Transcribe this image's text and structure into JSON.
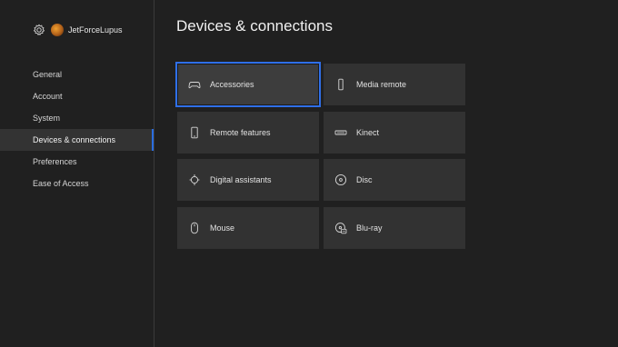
{
  "profile": {
    "gamertag": "JetForceLupus",
    "icons": [
      "gear-icon",
      "avatar"
    ]
  },
  "sidebar": {
    "items": [
      {
        "label": "General"
      },
      {
        "label": "Account"
      },
      {
        "label": "System"
      },
      {
        "label": "Devices & connections",
        "active": true
      },
      {
        "label": "Preferences"
      },
      {
        "label": "Ease of Access"
      }
    ]
  },
  "main": {
    "title": "Devices & connections",
    "tiles": [
      {
        "label": "Accessories",
        "icon": "controller-icon",
        "selected": true
      },
      {
        "label": "Media remote",
        "icon": "remote-icon"
      },
      {
        "label": "Remote features",
        "icon": "phone-icon"
      },
      {
        "label": "Kinect",
        "icon": "kinect-icon"
      },
      {
        "label": "Digital assistants",
        "icon": "assistant-icon"
      },
      {
        "label": "Disc",
        "icon": "disc-icon"
      },
      {
        "label": "Mouse",
        "icon": "mouse-icon"
      },
      {
        "label": "Blu-ray",
        "icon": "bluray-icon"
      }
    ]
  },
  "colors": {
    "background": "#202020",
    "tile": "#323232",
    "selected_border": "#2f6fe8",
    "active_nav": "#333333",
    "accent_bar": "#2a6de0"
  }
}
